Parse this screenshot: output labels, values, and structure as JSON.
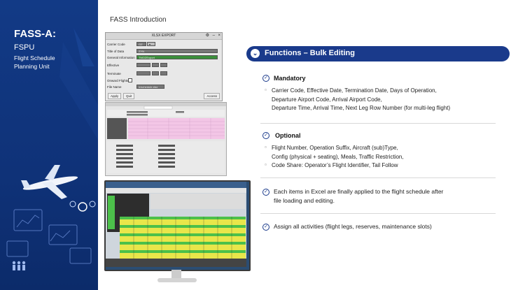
{
  "sidebar": {
    "title": "FASS-A:",
    "subtitle": "FSPU",
    "desc_line1": "Flight Schedule",
    "desc_line2": "Planning Unit"
  },
  "header": {
    "title": "FASS Introduction"
  },
  "xlsx_dialog": {
    "title": "XLSX EXPORT",
    "fields": {
      "carrier_code": "Carrier Code",
      "carrier_value": "OZ",
      "title_of_data": "Title of Data",
      "title_value": "ZYN",
      "general_info": "General Information",
      "general_value": "TMOZExport",
      "effective": "Effective",
      "terminate": "Terminate",
      "onward_flights": "Onward Flights",
      "file_name": "File Name",
      "file_value": "h/schedule.xlsx"
    },
    "buttons": {
      "apply": "Apply",
      "quit": "Quit",
      "access": "Access"
    }
  },
  "banner": {
    "title": "Functions – Bulk Editing"
  },
  "mandatory": {
    "heading": "Mandatory",
    "line1": "Carrier Code, Effective Date, Termination Date, Days of Operation,",
    "line2": "Departure Airport Code,  Arrival Airport Code,",
    "line3": "Departure Time, Arrival Time, Next Leg Row Number (for multi-leg flight)"
  },
  "optional": {
    "heading": "Optional",
    "line1": "Flight Number, Operation Suffix, Aircraft (sub)Type,",
    "line2": "Config (physical +   seating), Meals, Traffic Restriction,",
    "line3": "Code Share: Operator’s Flight Identifier, Tail Follow"
  },
  "notes": {
    "excel_line1": "Each items in Excel are finally applied to the flight schedule after",
    "excel_line2": "file loading and editing.",
    "assign": "Assign all activities (flight legs, reserves, maintenance slots)"
  },
  "colors": {
    "sidebar": "#123a86",
    "banner": "#1a3a8b",
    "grid_yellow": "#e9e64a",
    "grid_green": "#4cc04a",
    "grid_pink": "#f3c6e6"
  }
}
